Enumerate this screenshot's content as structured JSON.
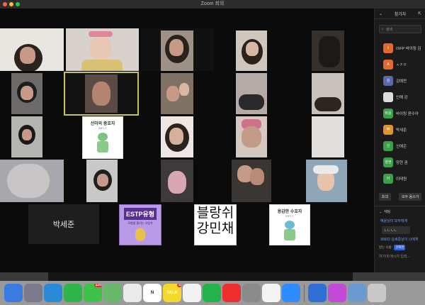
{
  "window": {
    "title": "Zoom 회의"
  },
  "gallery": {
    "name_tile": "박세준",
    "card1": {
      "title": "선미의 중호자",
      "subtitle": "INFJ-T"
    },
    "card2": {
      "title": "용감한 수호자",
      "subtitle": "ISFJ-T"
    },
    "estp": {
      "title": "ESTP유형",
      "subtitle": "모험을 즐기는 사업가"
    },
    "handwriting": {
      "line1": "블랑쉬",
      "line2": "강민채"
    }
  },
  "panel": {
    "header_title": "참가자",
    "search_placeholder": "검색",
    "participants": [
      {
        "avatar": "I",
        "name": "ISFP 바이링 김",
        "color": "#e06b2c"
      },
      {
        "avatar": "A",
        "name": "ㅅㅈㅇ",
        "color": "#e06b2c"
      },
      {
        "avatar": "김",
        "name": "김예찬",
        "color": "#5a6aa8"
      },
      {
        "avatar": "",
        "name": "인해 강",
        "color": "#dddddd"
      },
      {
        "avatar": "바윤",
        "name": "바이링 윤수아",
        "color": "#3aa04a"
      },
      {
        "avatar": "박",
        "name": "박세준",
        "color": "#e0922c"
      },
      {
        "avatar": "신",
        "name": "신예은",
        "color": "#3aa04a"
      },
      {
        "avatar": "양현",
        "name": "양현 권",
        "color": "#3aa04a"
      },
      {
        "avatar": "이",
        "name": "이태원",
        "color": "#3aa04a"
      }
    ],
    "buttons": {
      "invite": "초대",
      "mute_all": "모두 음소거"
    },
    "chat": {
      "title": "채팅",
      "from": "혜윤님이 모두에게",
      "message": "ㄴㄴㄴㄴ",
      "from2": "30602 김세준님이 나에게",
      "to_label": "받는 사람:",
      "to_value": "선택된",
      "input_placeholder": "여기에 메시지 입력..."
    }
  },
  "dock": {
    "items": [
      {
        "name": "finder-icon",
        "label": "",
        "color": "#3a7be0"
      },
      {
        "name": "launchpad-icon",
        "label": "",
        "color": "#7a7a8a"
      },
      {
        "name": "safari-icon",
        "label": "",
        "color": "#2a8ad8"
      },
      {
        "name": "facetime-icon",
        "label": "",
        "color": "#2fb44a"
      },
      {
        "name": "messages-icon",
        "label": "",
        "color": "#3fc24a",
        "badge": "124"
      },
      {
        "name": "maps-icon",
        "label": "",
        "color": "#68b86a"
      },
      {
        "name": "chrome-icon",
        "label": "",
        "color": "#eaeaea"
      },
      {
        "name": "notion-icon",
        "label": "N",
        "color": "#ffffff"
      },
      {
        "name": "kakaotalk-icon",
        "label": "TALK",
        "color": "#f5d82c",
        "badge": "6"
      },
      {
        "name": "photos-icon",
        "label": "",
        "color": "#f2f2f2"
      },
      {
        "name": "line-icon",
        "label": "",
        "color": "#24b34a"
      },
      {
        "name": "youtube-icon",
        "label": "",
        "color": "#ee2f2f"
      },
      {
        "name": "settings-icon",
        "label": "",
        "color": "#8a8a8a"
      },
      {
        "name": "music-icon",
        "label": "",
        "color": "#f3f3f3"
      },
      {
        "name": "zoom-icon",
        "label": "",
        "color": "#2d8cff"
      },
      {
        "name": "file-icon",
        "label": "",
        "color": "#2f6fd6"
      },
      {
        "name": "podcast-icon",
        "label": "",
        "color": "#c24ad6"
      },
      {
        "name": "preview-icon",
        "label": "",
        "color": "#6a9ad0"
      },
      {
        "name": "trash-icon",
        "label": "",
        "color": "#c8c8c8"
      }
    ]
  }
}
